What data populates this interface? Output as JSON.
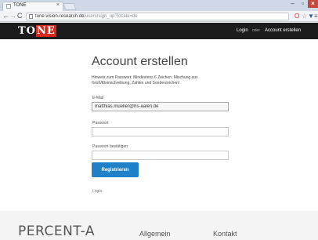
{
  "browser": {
    "tab_title": "TONE",
    "tab_close": "×",
    "window_minimize": "–",
    "window_maximize": "▫",
    "window_close": "×",
    "back_icon": "←",
    "forward_icon": "→",
    "reload_icon": "C",
    "url_host": "tone.vision-research.de",
    "url_path": "/users/sign_up?locale=de",
    "opera_icon": "O",
    "star_icon": "☆",
    "shield_icon": "▼",
    "menu_icon": "≡"
  },
  "header": {
    "logo_to": "TO",
    "logo_ne": "NE",
    "login_label": "Login",
    "separator": "oder",
    "create_label": "Account erstellen"
  },
  "form": {
    "title": "Account erstellen",
    "hint": "Hinweis zum Passwort: Mindestens 6 Zeichen. Mischung aus Groß/Kleinschreibung, Zahlen und Sonderzeichen!",
    "email_label": "E-Mail",
    "email_value": "matthias.mueller@hs-aalen.de",
    "password_label": "Passwort",
    "password_value": "",
    "confirm_label": "Passwort bestätigen",
    "confirm_value": "",
    "submit_label": "Registrieren",
    "login_link": "Login"
  },
  "footer": {
    "logo": "PERCENT-A",
    "general": "Allgemein",
    "contact": "Kontakt"
  },
  "colors": {
    "header_bg": "#1c1c1c",
    "logo_accent": "#d7281d",
    "button": "#1f82c8"
  }
}
